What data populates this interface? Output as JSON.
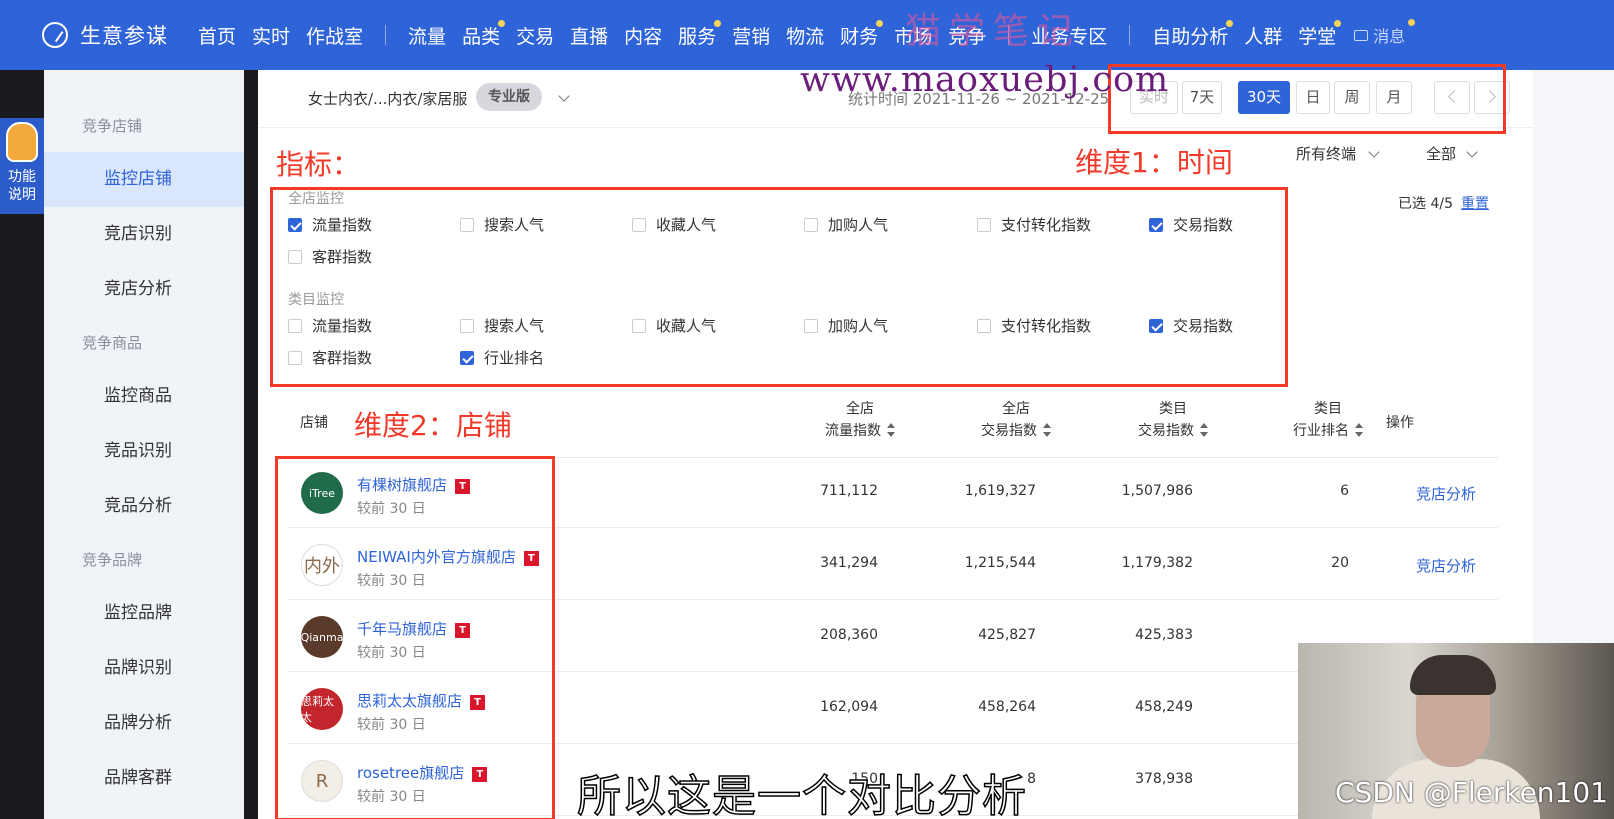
{
  "app": {
    "title": "生意参谋"
  },
  "nav": {
    "items": [
      "首页",
      "实时",
      "作战室"
    ],
    "items2": [
      "流量",
      "品类",
      "交易",
      "直播",
      "内容",
      "服务",
      "营销",
      "物流",
      "财务",
      "市场",
      "竞争"
    ],
    "items3": [
      "业务专区"
    ],
    "items4": [
      "自助分析",
      "人群",
      "学堂"
    ],
    "message": "消息"
  },
  "watermark": {
    "top": "猫学笔记",
    "url": "www.maoxuebj.com"
  },
  "help_tab": "功能说明",
  "sidebar": {
    "groups": [
      {
        "title": "竞争店铺",
        "items": [
          "监控店铺",
          "竞店识别",
          "竞店分析"
        ]
      },
      {
        "title": "竞争商品",
        "items": [
          "监控商品",
          "竞品识别",
          "竞品分析"
        ]
      },
      {
        "title": "竞争品牌",
        "items": [
          "监控品牌",
          "品牌识别",
          "品牌分析",
          "品牌客群"
        ]
      }
    ]
  },
  "filter": {
    "category": "女士内衣/...内衣/家居服",
    "edition": "专业版",
    "stat_time": "统计时间 2021-11-26 ~ 2021-12-25",
    "time_buttons": [
      "实时",
      "7天",
      "30天",
      "日",
      "周",
      "月"
    ],
    "active_time": "30天",
    "terminal": "所有终端",
    "scope": "全部"
  },
  "annotations": {
    "indicator": "指标：",
    "dim1": "维度1：时间",
    "dim2": "维度2：店铺"
  },
  "metrics": {
    "shop_title": "全店监控",
    "shop_items": [
      {
        "label": "流量指数",
        "checked": true
      },
      {
        "label": "搜索人气",
        "checked": false
      },
      {
        "label": "收藏人气",
        "checked": false
      },
      {
        "label": "加购人气",
        "checked": false
      },
      {
        "label": "支付转化指数",
        "checked": false
      },
      {
        "label": "交易指数",
        "checked": true
      },
      {
        "label": "客群指数",
        "checked": false
      }
    ],
    "cat_title": "类目监控",
    "cat_items": [
      {
        "label": "流量指数",
        "checked": false
      },
      {
        "label": "搜索人气",
        "checked": false
      },
      {
        "label": "收藏人气",
        "checked": false
      },
      {
        "label": "加购人气",
        "checked": false
      },
      {
        "label": "支付转化指数",
        "checked": false
      },
      {
        "label": "交易指数",
        "checked": true
      },
      {
        "label": "客群指数",
        "checked": false
      },
      {
        "label": "行业排名",
        "checked": true
      }
    ],
    "selected": "已选 4/5",
    "reset": "重置"
  },
  "table": {
    "headers": {
      "shop": "店铺",
      "c1a": "全店",
      "c1b": "流量指数",
      "c2a": "全店",
      "c2b": "交易指数",
      "c3a": "类目",
      "c3b": "交易指数",
      "c4a": "类目",
      "c4b": "行业排名",
      "op": "操作"
    },
    "rows": [
      {
        "name": "有棵树旗舰店",
        "sub": "较前 30 日",
        "traffic": "711,112",
        "trade": "1,619,327",
        "cat_trade": "1,507,986",
        "rank": "6",
        "op": "竞店分析",
        "logo_text": "iTree",
        "logo_color": "#1f6b4a"
      },
      {
        "name": "NEIWAI内外官方旗舰店",
        "sub": "较前 30 日",
        "traffic": "341,294",
        "trade": "1,215,544",
        "cat_trade": "1,179,382",
        "rank": "20",
        "op": "竞店分析",
        "logo_text": "内外",
        "logo_color": "#ffffff"
      },
      {
        "name": "千年马旗舰店",
        "sub": "较前 30 日",
        "traffic": "208,360",
        "trade": "425,827",
        "cat_trade": "425,383",
        "rank": "",
        "op": "",
        "logo_text": "Qianma",
        "logo_color": "#5a3a2a"
      },
      {
        "name": "思莉太太旗舰店",
        "sub": "较前 30 日",
        "traffic": "162,094",
        "trade": "458,264",
        "cat_trade": "458,249",
        "rank": "",
        "op": "",
        "logo_text": "思莉太太",
        "logo_color": "#c2262c"
      },
      {
        "name": "rosetree旗舰店",
        "sub": "较前 30 日",
        "traffic": "150",
        "trade": "8",
        "cat_trade": "378,938",
        "rank": "",
        "op": "",
        "logo_text": "R",
        "logo_color": "#f3efe6"
      }
    ]
  },
  "overlay": {
    "subtitle": "所以这是一个对比分析",
    "credit": "CSDN @Flerken101"
  }
}
